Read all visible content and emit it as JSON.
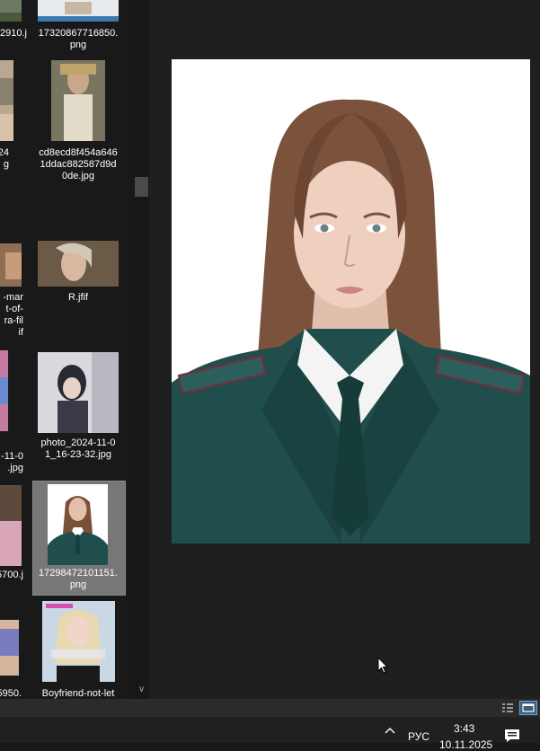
{
  "file_list": {
    "items": [
      {
        "caption": "2910.j",
        "column": "left"
      },
      {
        "caption": "17320867716850.\npng",
        "column": "right"
      },
      {
        "caption": "24\ng",
        "column": "left"
      },
      {
        "caption": "cd8ecd8f454a646\n1ddac882587d9d\n0de.jpg",
        "column": "right"
      },
      {
        "caption": "-mar\nt-of-\nra-fil\nif",
        "column": "left"
      },
      {
        "caption": "R.jfif",
        "column": "right"
      },
      {
        "caption": "-11-0\n.jpg",
        "column": "left"
      },
      {
        "caption": "photo_2024-11-0\n1_16-23-32.jpg",
        "column": "right"
      },
      {
        "caption": "5700.j",
        "column": "left"
      },
      {
        "caption": "17298472101151.\npng",
        "column": "right",
        "selected": true
      },
      {
        "caption": "5950.",
        "column": "left"
      },
      {
        "caption": "Boyfriend-not-let",
        "column": "right"
      }
    ]
  },
  "taskbar": {
    "language": "РУС",
    "time": "3:43",
    "date": "10.11.2025"
  },
  "colors": {
    "background": "#191919",
    "selected": "#777777",
    "uniform": "#1f4e4c"
  },
  "icons": {
    "chevron_up": "chevron-up-icon",
    "notifications": "notifications-icon",
    "details_view": "details-view-icon",
    "thumbnail_view": "thumbnail-view-icon",
    "cursor": "mouse-pointer-icon"
  }
}
